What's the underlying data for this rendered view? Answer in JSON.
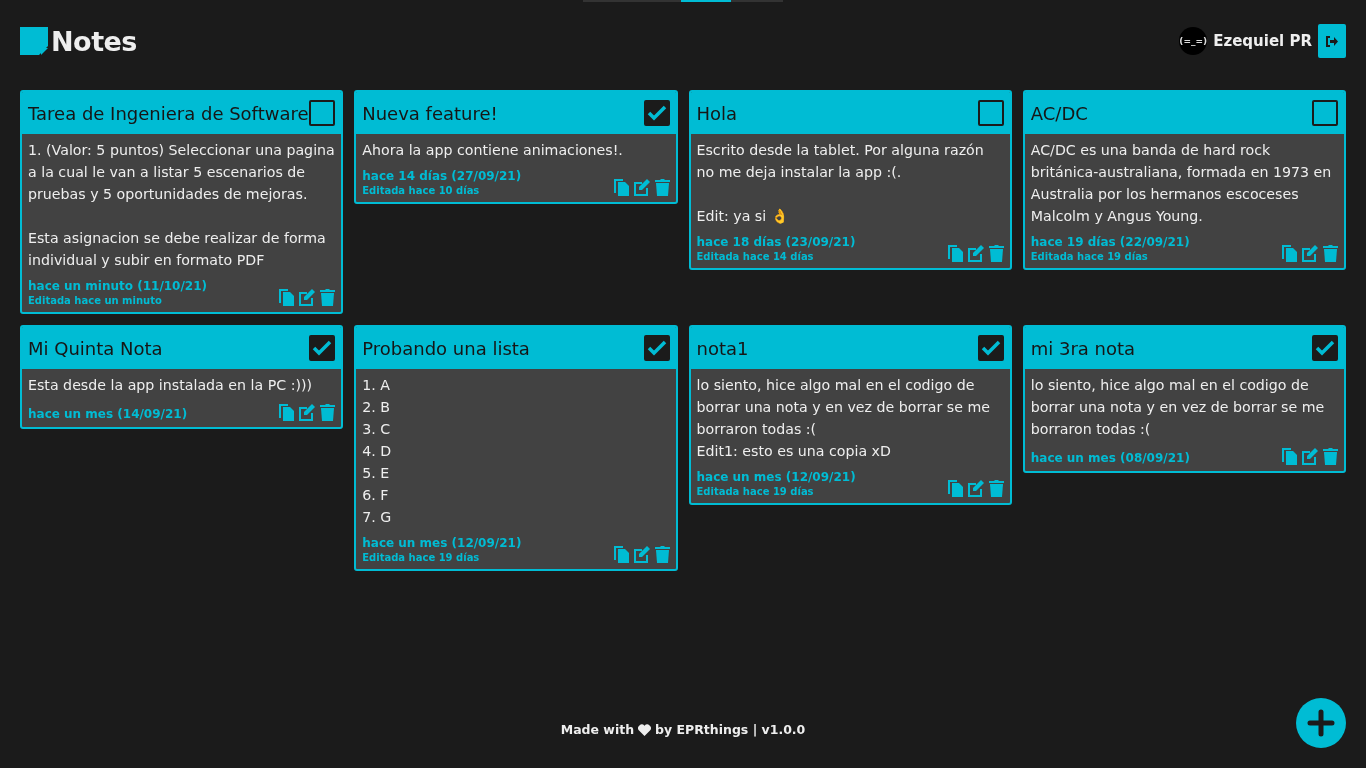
{
  "app": {
    "title": "Notes"
  },
  "user": {
    "avatar_text": "(=_=)",
    "name": "Ezequiel PR"
  },
  "notes": [
    {
      "title": "Tarea de Ingeniera de Software",
      "checked": false,
      "body": "1. (Valor: 5 puntos) Seleccionar una pagina a la cual le van a listar 5 escenarios de pruebas y 5 oportunidades de mejoras.\n\nEsta asignacion se debe realizar de forma individual y subir en formato PDF",
      "date": "hace un minuto (11/10/21)",
      "edited": "Editada hace un minuto"
    },
    {
      "title": "Nueva feature!",
      "checked": true,
      "body": "Ahora la app contiene animaciones!.",
      "date": "hace 14 días (27/09/21)",
      "edited": "Editada hace 10 días"
    },
    {
      "title": "Hola",
      "checked": false,
      "body": "Escrito desde la tablet. Por alguna razón no me deja instalar la app :(.\n\nEdit: ya si 👌",
      "date": "hace 18 días (23/09/21)",
      "edited": "Editada hace 14 días"
    },
    {
      "title": "AC/DC",
      "checked": false,
      "body": "AC/DC es una banda de hard rock británica-australiana, formada en 1973 en Australia por los hermanos escoceses Malcolm y Angus Young.",
      "date": "hace 19 días (22/09/21)",
      "edited": "Editada hace 19 días"
    },
    {
      "title": "Mi Quinta Nota",
      "checked": true,
      "body": "Esta desde la app instalada en la PC :)))",
      "date": "hace un mes (14/09/21)"
    },
    {
      "title": "Probando una lista",
      "checked": true,
      "body": "1. A\n2. B\n3. C\n4. D\n5. E\n6. F\n7. G",
      "date": "hace un mes (12/09/21)",
      "edited": "Editada hace 19 días"
    },
    {
      "title": "nota1",
      "checked": true,
      "body": "lo siento, hice algo mal en el codigo de borrar una nota y en vez de borrar se me borraron todas :(\nEdit1: esto es una copia xD",
      "date": "hace un mes (12/09/21)",
      "edited": "Editada hace 19 días"
    },
    {
      "title": "mi 3ra nota",
      "checked": true,
      "body": "lo siento, hice algo mal en el codigo de borrar una nota y en vez de borrar se me borraron todas :(",
      "date": "hace un mes (08/09/21)"
    }
  ],
  "footer": {
    "before_icon": "Made with",
    "after_icon": "by EPRthings | v1.0.0"
  }
}
